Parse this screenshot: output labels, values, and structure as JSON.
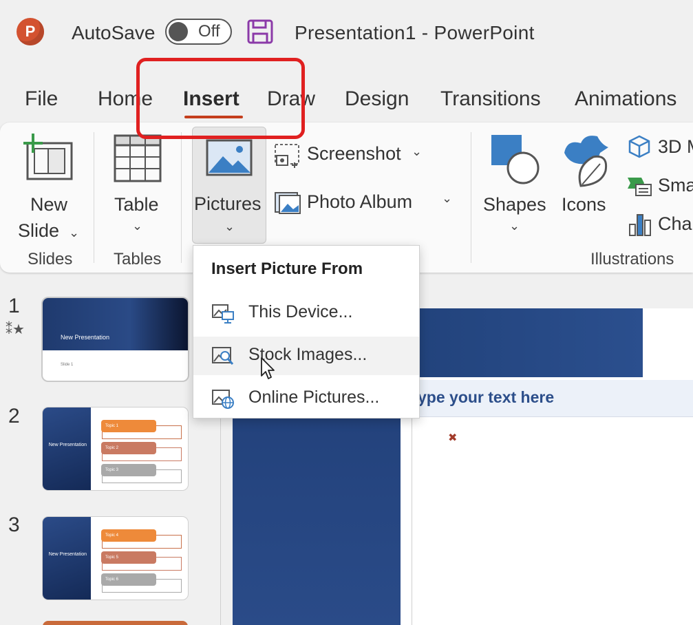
{
  "titlebar": {
    "app_logo_letter": "P",
    "autosave_label": "AutoSave",
    "autosave_state": "Off",
    "doc_title": "Presentation1  -  PowerPoint"
  },
  "tabs": [
    "File",
    "Home",
    "Insert",
    "Draw",
    "Design",
    "Transitions",
    "Animations"
  ],
  "active_tab": "Insert",
  "ribbon": {
    "new_slide_line1": "New",
    "new_slide_line2": "Slide",
    "table": "Table",
    "pictures": "Pictures",
    "screenshot": "Screenshot",
    "photo_album": "Photo Album",
    "shapes": "Shapes",
    "icons": "Icons",
    "three_d": "3D M",
    "smartart": "Sma",
    "chart": "Cha",
    "groups": {
      "slides": "Slides",
      "tables": "Tables",
      "illustrations": "Illustrations"
    }
  },
  "dropdown": {
    "title": "Insert Picture From",
    "items": [
      {
        "label": "This Device...",
        "icon": "device-picture-icon"
      },
      {
        "label": "Stock Images...",
        "icon": "stock-images-icon"
      },
      {
        "label": "Online Pictures...",
        "icon": "online-pictures-icon"
      }
    ]
  },
  "slides": {
    "numbers": [
      "1",
      "2",
      "3"
    ],
    "thumb1_title": "New Presentation",
    "thumb1_sub": "Slide 1",
    "thumb_left_title": "New Presentation",
    "thumb2_topics": [
      "Topic 1",
      "Topic 2",
      "Topic 3"
    ],
    "thumb3_topics": [
      "Topic 4",
      "Topic 5",
      "Topic 6"
    ]
  },
  "text_pane": {
    "placeholder": "ype your text here"
  },
  "colors": {
    "accent": "#c43e1c",
    "highlight": "#e02020",
    "slide_blue": "#23427c",
    "topic_orange": "#ee8a3a",
    "topic_salmon": "#c97a62",
    "topic_gray": "#a9a9a9"
  }
}
